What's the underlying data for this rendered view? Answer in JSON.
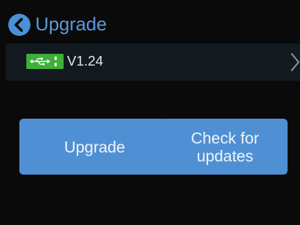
{
  "header": {
    "title": "Upgrade",
    "back_icon": "chevron-left-icon"
  },
  "version_row": {
    "icon": "usb-icon",
    "version": "V1.24",
    "arrow_icon": "chevron-right-icon"
  },
  "actions": {
    "upgrade_label": "Upgrade",
    "check_label": "Check for\nupdates"
  },
  "colors": {
    "background": "#0a0a0a",
    "accent": "#4a90d9",
    "title": "#5a9be0",
    "button": "#4f90d4",
    "usb_badge": "#3fae3a",
    "row_background": "#121a1f"
  }
}
